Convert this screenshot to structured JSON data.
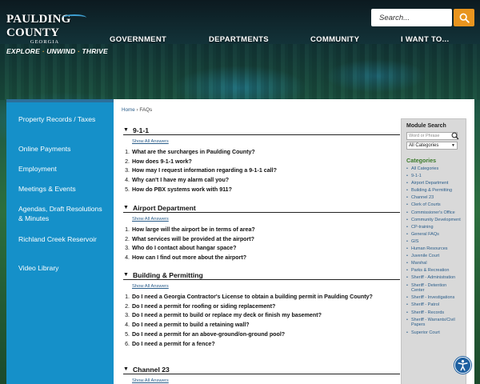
{
  "header": {
    "logo_title": "PAULDING COUNTY",
    "logo_subtitle": "GEORGIA",
    "logo_tagline_1": "EXPLORE",
    "logo_tagline_2": "UNWIND",
    "logo_tagline_3": "THRIVE",
    "logo_tagline_sep": "·",
    "search_placeholder": "Search...",
    "nav": [
      "GOVERNMENT",
      "DEPARTMENTS",
      "COMMUNITY",
      "I WANT TO..."
    ]
  },
  "sidebar": {
    "items": [
      "Property Records / Taxes",
      "Online Payments",
      "Employment",
      "Meetings & Events",
      "Agendas, Draft Resolutions & Minutes",
      "Richland Creek Reservoir",
      "Video Library"
    ]
  },
  "breadcrumb": {
    "home": "Home",
    "sep": "›",
    "current": "FAQs"
  },
  "faq": {
    "show_all_label": "Show All Answers",
    "categories": [
      {
        "title": "9-1-1",
        "questions": [
          "What are the surcharges in Paulding County?",
          "How does 9-1-1 work?",
          "How may I request information regarding a 9-1-1 call?",
          "Why can't I have my alarm call you?",
          "How do PBX systems work with 911?"
        ]
      },
      {
        "title": "Airport Department",
        "questions": [
          "How large will the airport be in terms of area?",
          "What services will be provided at the airport?",
          "Who do I contact about hangar space?",
          "How can I find out more about the airport?"
        ]
      },
      {
        "title": "Building & Permitting",
        "questions": [
          "Do I need a Georgia Contractor's License to obtain a building permit in Paulding County?",
          "Do I need a permit for roofing or siding replacement?",
          "Do I need a permit to build or replace my deck or finish my basement?",
          "Do I need a permit to build a retaining wall?",
          "Do I need a permit for an above-ground/on-ground pool?",
          "Do I need a permit for a fence?"
        ]
      },
      {
        "title": "Channel 23",
        "questions": []
      }
    ]
  },
  "module_search": {
    "title": "Module Search",
    "input_placeholder": "Word or Phrase",
    "select_value": "All Categories",
    "categories_title": "Categories",
    "categories": [
      "All Categories",
      "9-1-1",
      "Airport Department",
      "Building & Permitting",
      "Channel 23",
      "Clerk of Courts",
      "Commissioner's Office",
      "Community Development",
      "CP-training",
      "General FAQs",
      "GIS",
      "Human Resources",
      "Juvenile Court",
      "Marshal",
      "Parks & Recreation",
      "Sheriff - Administration",
      "Sheriff - Detention Center",
      "Sheriff - Investigations",
      "Sheriff - Patrol",
      "Sheriff - Records",
      "Sheriff - Warrants/Civil Papers",
      "Superior Court"
    ]
  },
  "colors": {
    "sidebar_bg": "#1590c9",
    "search_button": "#e8951f",
    "link": "#2a5d8a",
    "categories_title": "#3a7a2a"
  }
}
